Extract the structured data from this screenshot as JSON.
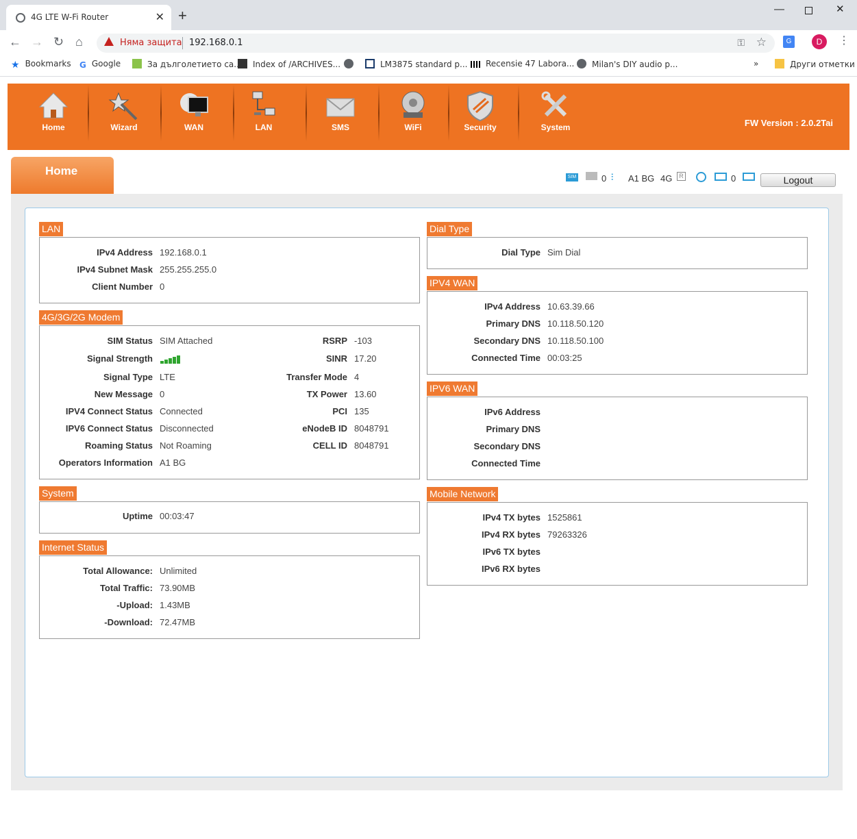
{
  "browser": {
    "tab_title": "4G LTE W-Fi Router",
    "security_label": "Няма защита",
    "url": "192.168.0.1",
    "avatar_letter": "D",
    "bookmarks": [
      {
        "label": "Bookmarks",
        "icon": "star-icon"
      },
      {
        "label": "Google",
        "icon": "google-icon"
      },
      {
        "label": "За дълголетието са...",
        "icon": "page-icon"
      },
      {
        "label": "Index of /ARCHIVES...",
        "icon": "page-icon"
      },
      {
        "label": "",
        "icon": "globe-icon"
      },
      {
        "label": "LM3875 standard p...",
        "icon": "grid-icon"
      },
      {
        "label": "Recensie 47 Labora...",
        "icon": "bars-icon"
      },
      {
        "label": "Milan's DIY audio p...",
        "icon": "globe-icon"
      }
    ],
    "other_bookmarks": "Други отметки"
  },
  "router": {
    "nav": [
      {
        "label": "Home",
        "icon": "home-icon"
      },
      {
        "label": "Wizard",
        "icon": "wand-icon"
      },
      {
        "label": "WAN",
        "icon": "wan-monitor-icon"
      },
      {
        "label": "LAN",
        "icon": "lan-computers-icon"
      },
      {
        "label": "SMS",
        "icon": "envelope-icon"
      },
      {
        "label": "WiFi",
        "icon": "wifi-router-icon"
      },
      {
        "label": "Security",
        "icon": "shield-icon"
      },
      {
        "label": "System",
        "icon": "tools-icon"
      }
    ],
    "fw_version": "FW Version : 2.0.2Tai",
    "page_tab": "Home",
    "status": {
      "sim": "SIM",
      "messages": "0",
      "operator": "A1 BG",
      "network": "4G",
      "roaming": "R",
      "clients": "0",
      "logout": "Logout"
    },
    "lan": {
      "title": "LAN",
      "rows": [
        {
          "label": "IPv4 Address",
          "value": "192.168.0.1"
        },
        {
          "label": "IPv4 Subnet Mask",
          "value": "255.255.255.0"
        },
        {
          "label": "Client Number",
          "value": "0"
        }
      ]
    },
    "modem": {
      "title": "4G/3G/2G Modem",
      "left": [
        {
          "label": "SIM Status",
          "value": "SIM Attached"
        },
        {
          "label": "Signal Strength",
          "value": ""
        },
        {
          "label": "Signal Type",
          "value": "LTE"
        },
        {
          "label": "New Message",
          "value": "0"
        },
        {
          "label": "IPV4 Connect Status",
          "value": "Connected"
        },
        {
          "label": "IPV6 Connect Status",
          "value": "Disconnected"
        },
        {
          "label": "Roaming Status",
          "value": "Not Roaming"
        },
        {
          "label": "Operators Information",
          "value": "A1 BG"
        }
      ],
      "right": [
        {
          "label": "RSRP",
          "value": "-103"
        },
        {
          "label": "SINR",
          "value": "17.20"
        },
        {
          "label": "Transfer Mode",
          "value": "4"
        },
        {
          "label": "TX Power",
          "value": "13.60"
        },
        {
          "label": "PCI",
          "value": "135"
        },
        {
          "label": "eNodeB ID",
          "value": "8048791"
        },
        {
          "label": "CELL ID",
          "value": "8048791"
        }
      ],
      "signal_bars": 5
    },
    "system": {
      "title": "System",
      "rows": [
        {
          "label": "Uptime",
          "value": "00:03:47"
        }
      ]
    },
    "internet": {
      "title": "Internet Status",
      "rows": [
        {
          "label": "Total Allowance:",
          "value": "Unlimited"
        },
        {
          "label": "Total Traffic:",
          "value": "73.90MB"
        },
        {
          "label": "-Upload:",
          "value": "1.43MB"
        },
        {
          "label": "-Download:",
          "value": "72.47MB"
        }
      ]
    },
    "dial": {
      "title": "Dial Type",
      "rows": [
        {
          "label": "Dial Type",
          "value": "Sim Dial"
        }
      ]
    },
    "ipv4wan": {
      "title": "IPV4 WAN",
      "rows": [
        {
          "label": "IPv4 Address",
          "value": "10.63.39.66"
        },
        {
          "label": "Primary DNS",
          "value": "10.118.50.120"
        },
        {
          "label": "Secondary DNS",
          "value": "10.118.50.100"
        },
        {
          "label": "Connected Time",
          "value": "00:03:25"
        }
      ]
    },
    "ipv6wan": {
      "title": "IPV6 WAN",
      "rows": [
        {
          "label": "IPv6 Address",
          "value": ""
        },
        {
          "label": "Primary DNS",
          "value": ""
        },
        {
          "label": "Secondary DNS",
          "value": ""
        },
        {
          "label": "Connected Time",
          "value": ""
        }
      ]
    },
    "mobile": {
      "title": "Mobile Network",
      "rows": [
        {
          "label": "IPv4 TX bytes",
          "value": "1525861"
        },
        {
          "label": "IPv4 RX bytes",
          "value": "79263326"
        },
        {
          "label": "IPv6 TX bytes",
          "value": ""
        },
        {
          "label": "IPv6 RX bytes",
          "value": ""
        }
      ]
    }
  },
  "colors": {
    "brand": "#ee7322",
    "section": "#ef7a31",
    "signal": "#2fa52f"
  }
}
